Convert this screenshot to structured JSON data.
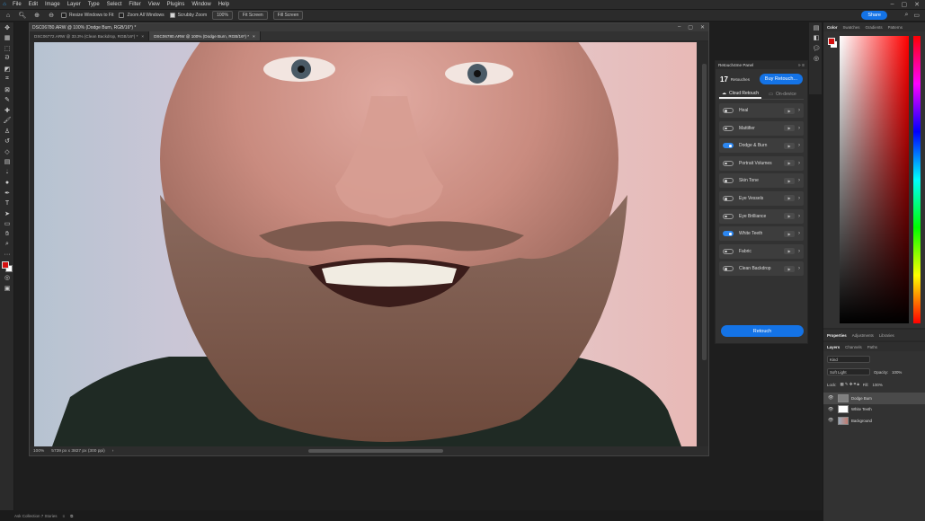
{
  "menubar": {
    "items": [
      "File",
      "Edit",
      "Image",
      "Layer",
      "Type",
      "Select",
      "Filter",
      "View",
      "Plugins",
      "Window",
      "Help"
    ]
  },
  "options": {
    "resize_windows": "Resize Windows to Fit",
    "zoom_all": "Zoom All Windows",
    "scrubby_zoom": "Scrubby Zoom",
    "zoom_value": "100%",
    "fit_screen": "Fit Screen",
    "fill_screen": "Fill Screen",
    "share": "Share"
  },
  "document": {
    "title": "DSC06780.ARW @ 100% (Dodge Burn, RGB/16*) *",
    "tabs": [
      {
        "label": "DSC06772.ARW @ 33.3% (Clean Backdrop, RGB/16*) *",
        "close": "×"
      },
      {
        "label": "DSC06780.ARW @ 100% (Dodge Burn, RGB/16*) *",
        "close": "×"
      }
    ],
    "zoom": "100%",
    "dimensions": "5739 px x 3827 px (300 ppi)"
  },
  "plugin": {
    "title": "Retouch4me Panel",
    "retouch_count": "17",
    "retouch_label": "Retouches",
    "buy_label": "Buy Retouch...",
    "tab_cloud": "Cloud Retouch",
    "tab_device": "On-device",
    "retouches": [
      {
        "name": "Heal",
        "on": false
      },
      {
        "name": "Mattifier",
        "on": false
      },
      {
        "name": "Dodge & Burn",
        "on": true
      },
      {
        "name": "Portrait Volumes",
        "on": false
      },
      {
        "name": "Skin Tone",
        "on": false
      },
      {
        "name": "Eye Vessels",
        "on": false
      },
      {
        "name": "Eye Brilliance",
        "on": false
      },
      {
        "name": "White Teeth",
        "on": true
      },
      {
        "name": "Fabric",
        "on": false
      },
      {
        "name": "Clean Backdrop",
        "on": false
      }
    ],
    "retouch_button": "Retouch"
  },
  "color_panel": {
    "tabs": [
      "Color",
      "Swatches",
      "Gradients",
      "Patterns"
    ],
    "foreground": "#d40f0f",
    "background": "#ffffff"
  },
  "properties_panel": {
    "tabs": [
      "Properties",
      "Adjustments",
      "Libraries"
    ]
  },
  "layers_panel": {
    "tabs": [
      "Layers",
      "Channels",
      "Paths"
    ],
    "filter_kind": "Kind",
    "blend_mode": "Soft Light",
    "opacity_label": "Opacity:",
    "opacity_value": "100%",
    "lock_label": "Lock:",
    "fill_label": "Fill:",
    "fill_value": "100%",
    "layers": [
      {
        "name": "Dodge Burn",
        "selected": true
      },
      {
        "name": "White Teeth",
        "selected": false
      },
      {
        "name": "Background",
        "selected": false
      }
    ]
  },
  "taskbar": {
    "items": [
      "Ask Collection 7 Stories",
      "≡",
      "⧉"
    ]
  }
}
